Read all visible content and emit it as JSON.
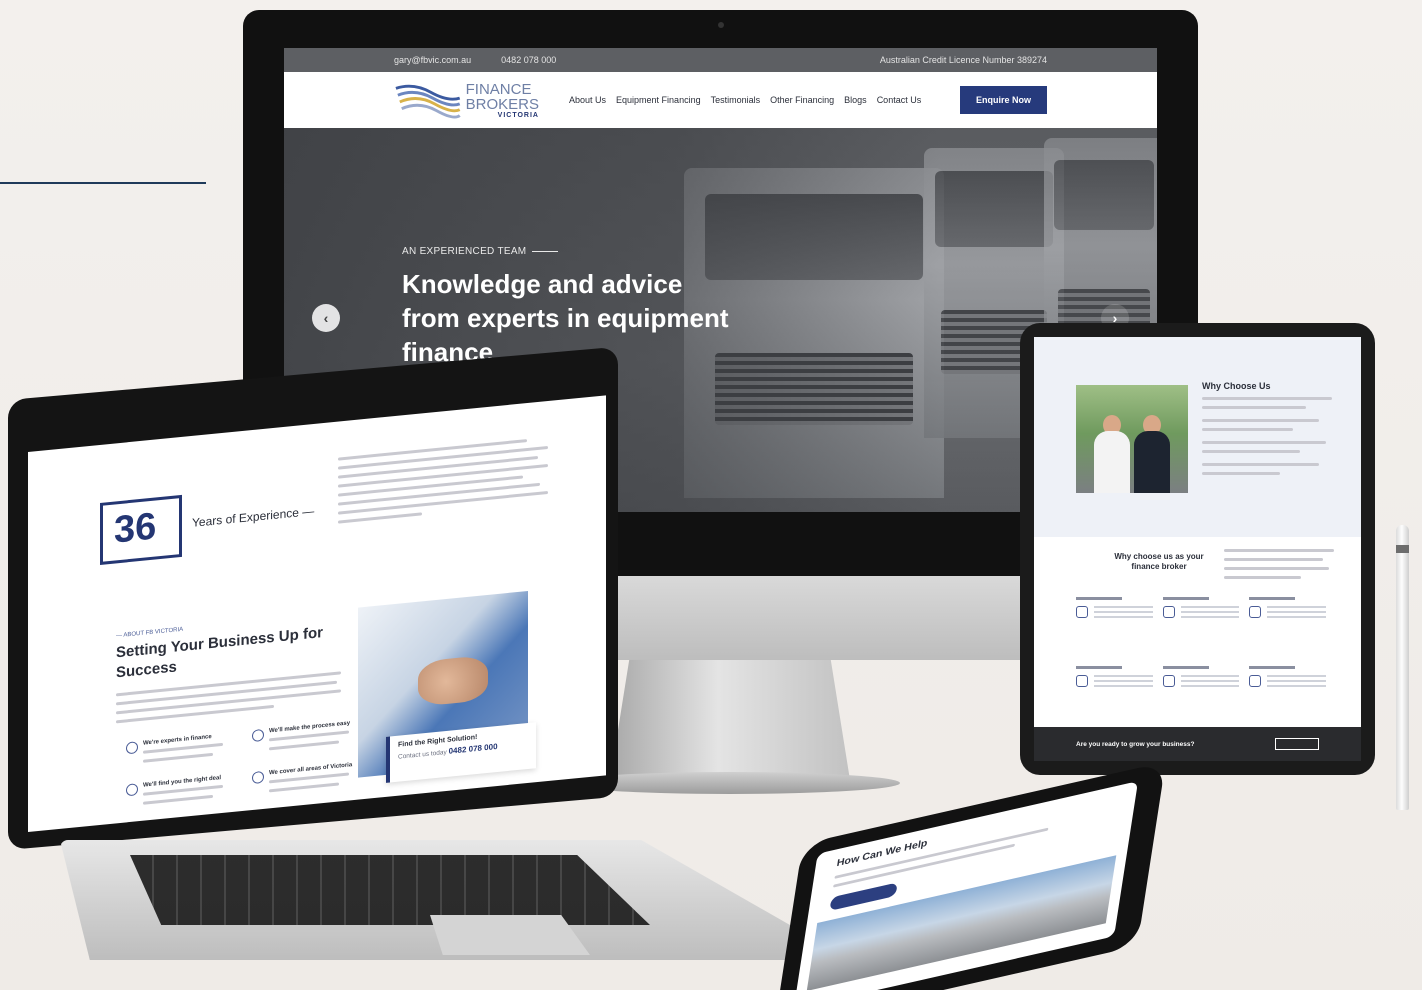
{
  "monitor_site": {
    "top_bar": {
      "email": "gary@fbvic.com.au",
      "phone": "0482 078 000",
      "licence": "Australian Credit Licence Number 389274"
    },
    "logo": {
      "line1": "FINANCE",
      "line2": "BROKERS",
      "line3": "VICTORIA"
    },
    "nav": {
      "items": [
        "About Us",
        "Equipment Financing",
        "Testimonials",
        "Other Financing",
        "Blogs",
        "Contact Us"
      ],
      "cta": "Enquire Now"
    },
    "hero": {
      "eyebrow": "AN EXPERIENCED TEAM",
      "title": "Knowledge and advice from experts in equipment finance",
      "prev_arrow": "‹",
      "next_arrow": "›"
    }
  },
  "laptop_site": {
    "years_number": "36",
    "years_label": "Years of Experience —",
    "eyebrow": "— ABOUT FB VICTORIA",
    "heading": "Setting Your Business Up for Success",
    "features": [
      "We're experts in finance",
      "We'll make the process easy",
      "We'll find you the right deal",
      "We cover all areas of Victoria"
    ],
    "cta_card": {
      "title": "Find the Right Solution!",
      "prefix": "Contact us today",
      "phone": "0482 078 000"
    }
  },
  "tablet_site": {
    "why_title": "Why Choose Us",
    "why_broker_title": "Why choose us as your finance broker",
    "footer_question": "Are you ready to grow your business?"
  },
  "phone_site": {
    "title": "How Can We Help"
  }
}
